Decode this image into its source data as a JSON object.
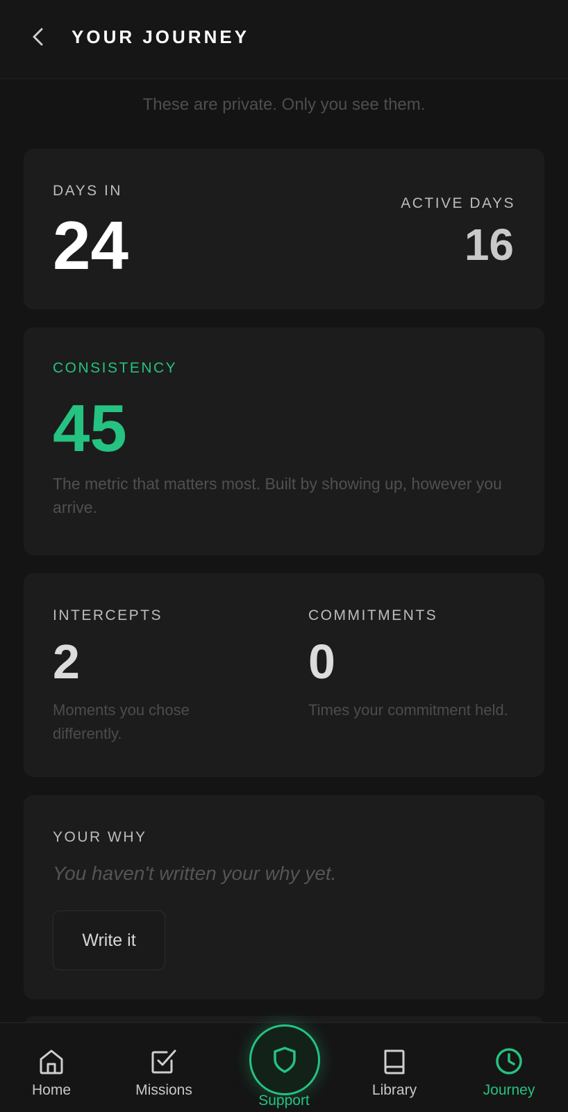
{
  "header": {
    "title": "YOUR JOURNEY"
  },
  "privacy_note": "These are private. Only you see them.",
  "days": {
    "days_in_label": "DAYS IN",
    "days_in_value": "24",
    "active_days_label": "ACTIVE DAYS",
    "active_days_value": "16"
  },
  "consistency": {
    "label": "CONSISTENCY",
    "value": "45",
    "description": "The metric that matters most. Built by showing up, however you arrive."
  },
  "stats": {
    "intercepts_label": "INTERCEPTS",
    "intercepts_value": "2",
    "intercepts_caption": "Moments you chose differently.",
    "commitments_label": "COMMITMENTS",
    "commitments_value": "0",
    "commitments_caption": "Times your commitment held."
  },
  "why": {
    "label": "YOUR WHY",
    "placeholder": "You haven't written your why yet.",
    "button_label": "Write it"
  },
  "nav": {
    "home": "Home",
    "missions": "Missions",
    "support": "Support",
    "library": "Library",
    "journey": "Journey"
  },
  "colors": {
    "accent": "#25c281",
    "background": "#141414",
    "card": "#1c1c1c"
  },
  "icons": {
    "back": "chevron-left-icon",
    "home": "home-icon",
    "missions": "checkbox-icon",
    "support": "shield-icon",
    "library": "book-icon",
    "journey": "clock-icon"
  }
}
